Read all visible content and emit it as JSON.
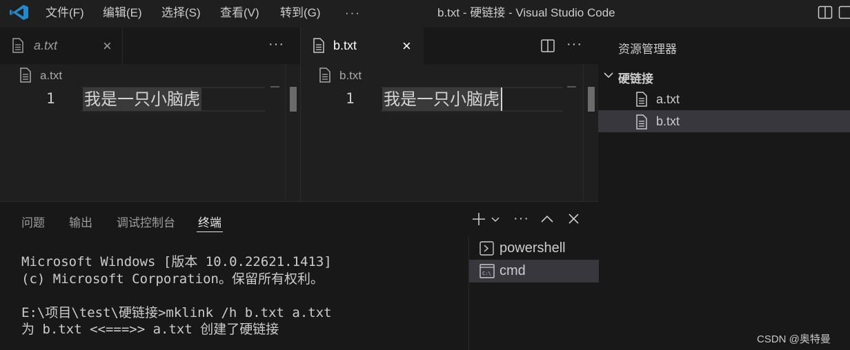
{
  "menu": [
    "文件(F)",
    "编辑(E)",
    "选择(S)",
    "查看(V)",
    "转到(G)",
    "···"
  ],
  "window_title": "b.txt - 硬链接 - Visual Studio Code",
  "editor_left": {
    "tab_label": "a.txt",
    "breadcrumb": "a.txt",
    "line_number": "1",
    "line_text": "我是一只小脑虎"
  },
  "editor_right": {
    "tab_label": "b.txt",
    "breadcrumb": "b.txt",
    "line_number": "1",
    "line_text": "我是一只小脑虎"
  },
  "explorer": {
    "title": "资源管理器",
    "folder": "硬链接",
    "files": [
      "a.txt",
      "b.txt"
    ],
    "selected_file": "b.txt"
  },
  "panel": {
    "tabs": [
      "问题",
      "输出",
      "调试控制台",
      "终端"
    ],
    "active_tab": "终端",
    "terminal_lines": [
      "Microsoft Windows [版本 10.0.22621.1413]",
      "(c) Microsoft Corporation。保留所有权利。",
      "",
      "E:\\项目\\test\\硬链接>mklink /h b.txt a.txt",
      "为 b.txt <<===>> a.txt 创建了硬链接"
    ],
    "terminals": [
      "powershell",
      "cmd"
    ],
    "selected_terminal": "cmd"
  },
  "watermark": "CSDN @奥特曼",
  "colors": {
    "background": "#1f1f1f",
    "sidebar": "#181818",
    "selection": "#37373d",
    "vscode_blue": "#2489ca"
  }
}
